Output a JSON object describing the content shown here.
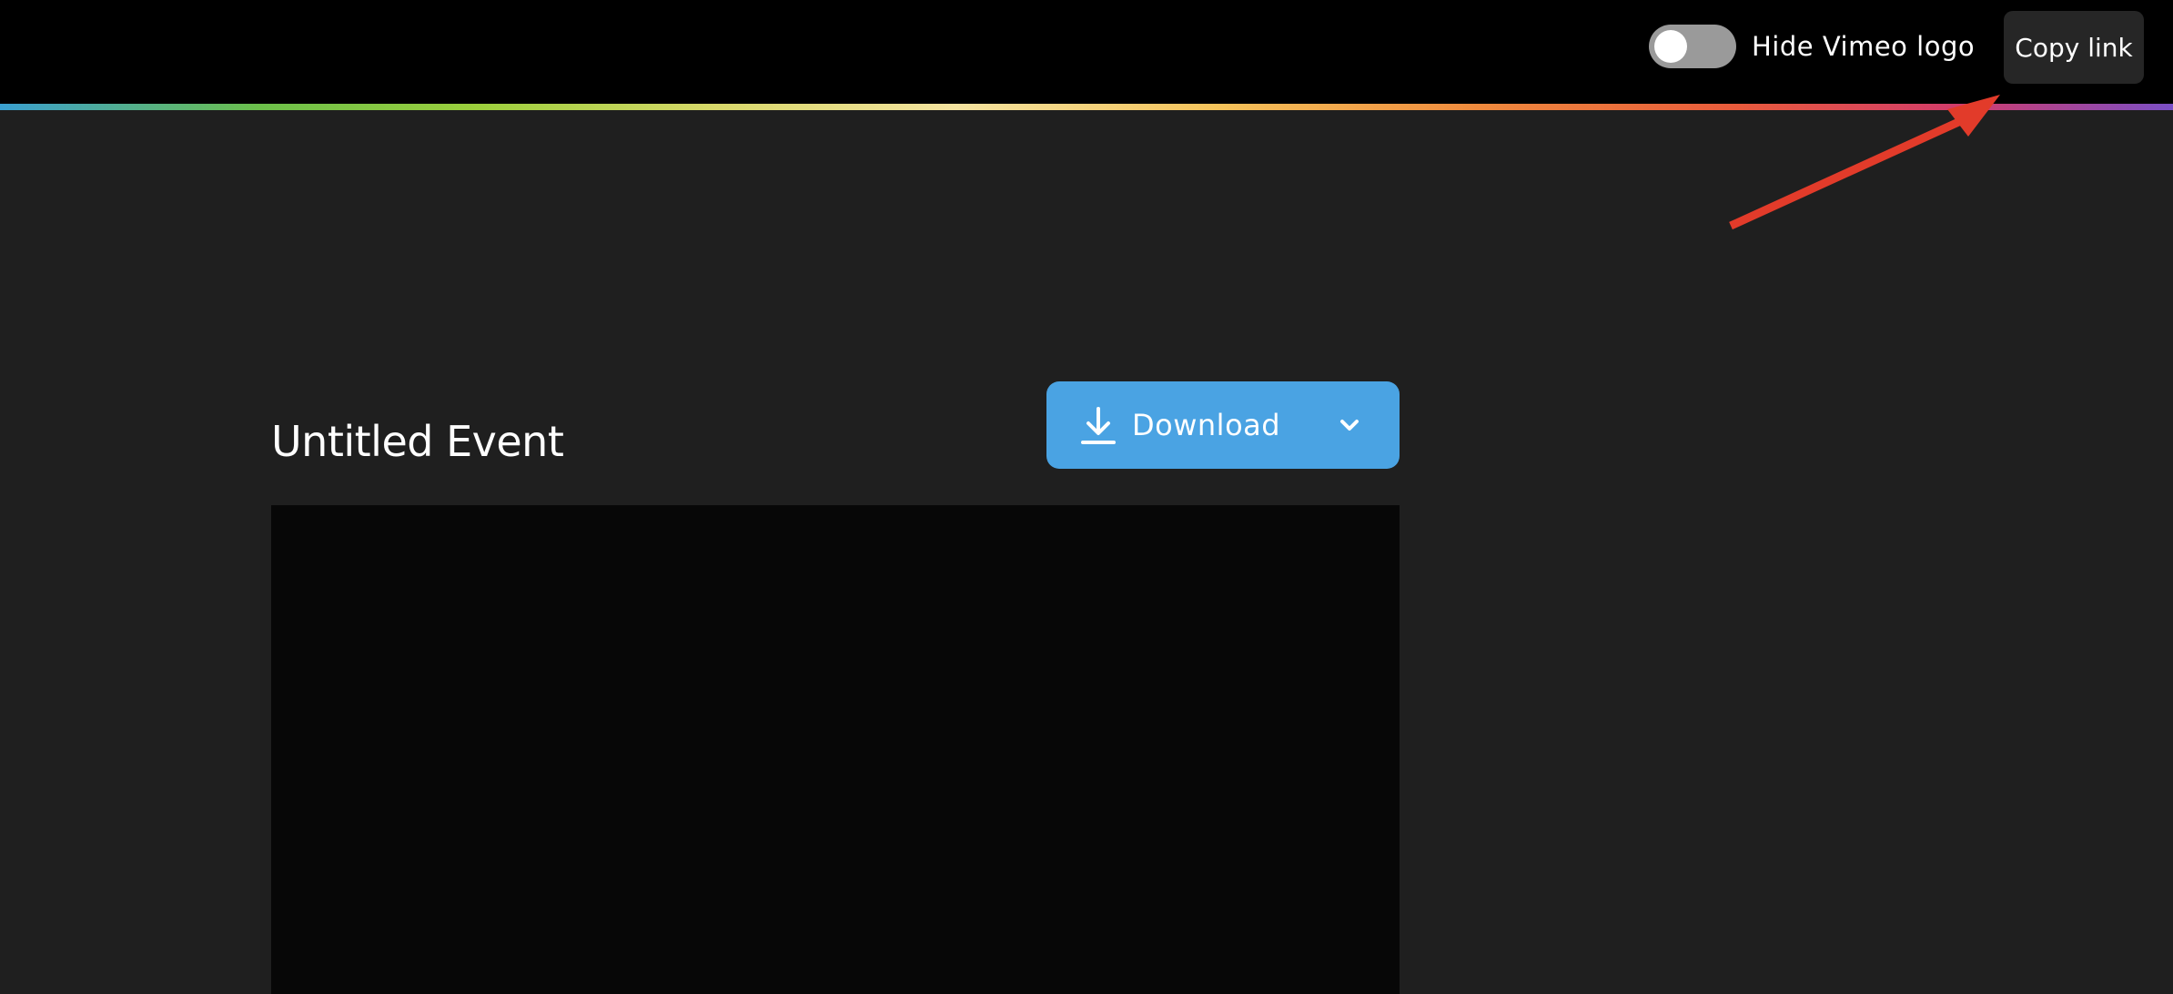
{
  "header": {
    "toggle_label": "Hide Vimeo logo",
    "toggle_state": "off",
    "copy_link_label": "Copy link"
  },
  "event": {
    "title": "Untitled Event"
  },
  "download": {
    "label": "Download",
    "icon": "download-icon",
    "dropdown_icon": "chevron-down-icon"
  },
  "annotation": {
    "arrow_color": "#e23b2a"
  },
  "colors": {
    "accent": "#4aa3e3",
    "background": "#1f1f1f",
    "topbar": "#000000"
  }
}
